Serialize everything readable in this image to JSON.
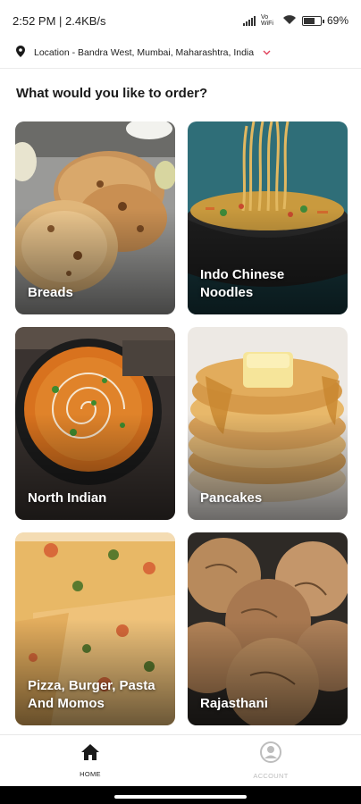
{
  "status_bar": {
    "time_speed": "2:52 PM | 2.4KB/s",
    "volte": "Vo WiFi",
    "battery": "69%",
    "battery_level": 0.69
  },
  "location": {
    "icon": "location-pin-icon",
    "text": "Location - Bandra West, Mumbai, Maharashtra, India",
    "dropdown_icon": "chevron-down-icon",
    "accent_color": "#e0405a"
  },
  "heading": "What would you like to order?",
  "categories": [
    {
      "label": "Breads"
    },
    {
      "label": "Indo Chinese Noodles"
    },
    {
      "label": "North Indian"
    },
    {
      "label": "Pancakes"
    },
    {
      "label": "Pizza, Burger, Pasta And Momos"
    },
    {
      "label": "Rajasthani"
    }
  ],
  "bottom_nav": {
    "home": {
      "label": "HOME",
      "icon": "home-icon"
    },
    "account": {
      "label": "ACCOUNT",
      "icon": "account-icon"
    }
  }
}
